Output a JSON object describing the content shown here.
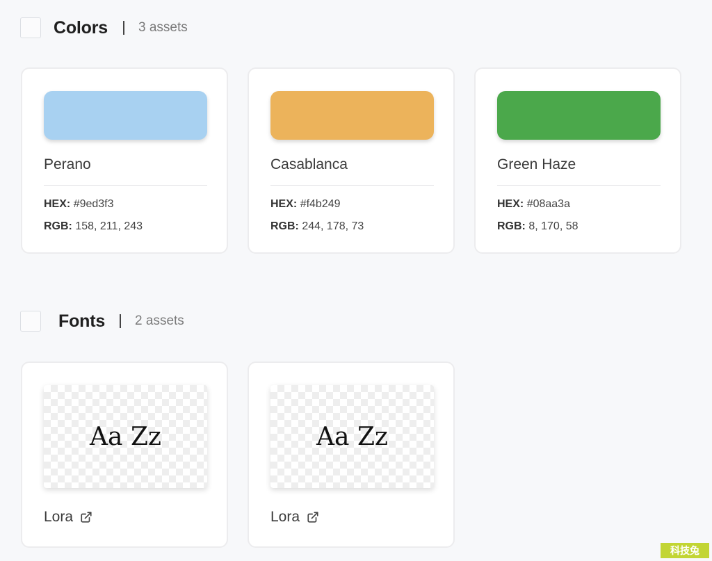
{
  "colors_section": {
    "title": "Colors",
    "count": "3 assets",
    "items": [
      {
        "name": "Perano",
        "hex_label": "HEX:",
        "hex": "#9ed3f3",
        "rgb_label": "RGB:",
        "rgb": "158, 211, 243",
        "swatch": "#a8d1f1"
      },
      {
        "name": "Casablanca",
        "hex_label": "HEX:",
        "hex": "#f4b249",
        "rgb_label": "RGB:",
        "rgb": "244, 178, 73",
        "swatch": "#ecb35b"
      },
      {
        "name": "Green Haze",
        "hex_label": "HEX:",
        "hex": "#08aa3a",
        "rgb_label": "RGB:",
        "rgb": "8, 170, 58",
        "swatch": "#4ba84b"
      }
    ]
  },
  "fonts_section": {
    "title": "Fonts",
    "count": "2 assets",
    "items": [
      {
        "sample": "Aa Zz",
        "name": "Lora",
        "icon": "external-link-icon"
      },
      {
        "sample": "Aa Zz",
        "name": "Lora",
        "icon": "external-link-icon"
      }
    ]
  },
  "watermark": "科技兔"
}
